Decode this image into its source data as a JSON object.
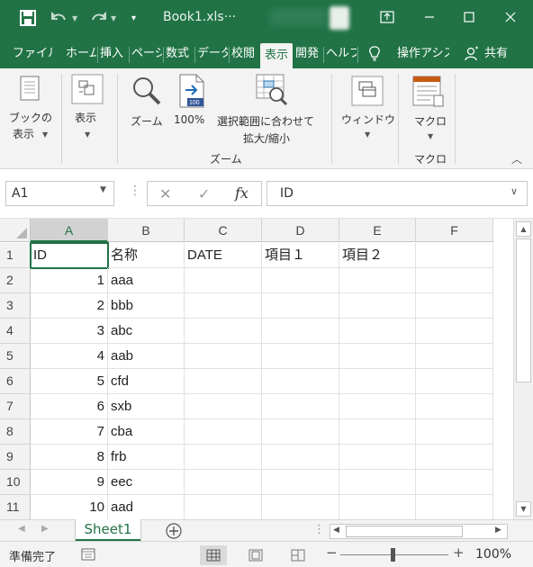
{
  "title_bar": {
    "file_title": "Book1.xls···",
    "icons": [
      "save-icon",
      "undo-icon",
      "redo-icon",
      "customize-qat-icon",
      "ribbon-display-options-icon",
      "minimize-icon",
      "maximize-icon",
      "close-icon"
    ]
  },
  "tabs": [
    {
      "label": "ファイル"
    },
    {
      "label": "ホーム"
    },
    {
      "label": "挿入"
    },
    {
      "label": "ページ"
    },
    {
      "label": "数式"
    },
    {
      "label": "データ"
    },
    {
      "label": "校閲"
    },
    {
      "label": "表示"
    },
    {
      "label": "開発"
    },
    {
      "label": "ヘルプ"
    },
    {
      "label": "操作アシスト"
    },
    {
      "label": "共有"
    }
  ],
  "ribbon": {
    "book_view": {
      "line1": "ブックの",
      "line2": "表示"
    },
    "display": {
      "label": "表示"
    },
    "zoom_btn": {
      "label": "ズーム"
    },
    "zoom100": {
      "label": "100%"
    },
    "zoom_selection": {
      "line1": "選択範囲に合わせて",
      "line2": "拡大/縮小"
    },
    "zoom_group_label": "ズーム",
    "window": {
      "label": "ウィンドウ"
    },
    "macro": {
      "label": "マクロ"
    },
    "macro_group_label": "マクロ"
  },
  "formula_bar": {
    "name_box": "A1",
    "fx": "fx",
    "formula": "ID"
  },
  "columns": [
    "A",
    "B",
    "C",
    "D",
    "E",
    "F"
  ],
  "selected_column": "A",
  "header_row": [
    "ID",
    "名称",
    "DATE",
    "項目１",
    "項目２",
    ""
  ],
  "rows": [
    {
      "num": "1"
    },
    {
      "num": "2",
      "id": "1",
      "name": "aaa"
    },
    {
      "num": "3",
      "id": "2",
      "name": "bbb"
    },
    {
      "num": "4",
      "id": "3",
      "name": "abc"
    },
    {
      "num": "5",
      "id": "4",
      "name": "aab"
    },
    {
      "num": "6",
      "id": "5",
      "name": "cfd"
    },
    {
      "num": "7",
      "id": "6",
      "name": "sxb"
    },
    {
      "num": "8",
      "id": "7",
      "name": "cba"
    },
    {
      "num": "9",
      "id": "8",
      "name": "frb"
    },
    {
      "num": "10",
      "id": "9",
      "name": "eec"
    },
    {
      "num": "11",
      "id": "10",
      "name": "aad"
    }
  ],
  "sheet_tabs": [
    {
      "label": "Sheet1"
    }
  ],
  "status": {
    "ready": "準備完了",
    "zoom": "100%"
  },
  "colors": {
    "accent": "#217346"
  }
}
